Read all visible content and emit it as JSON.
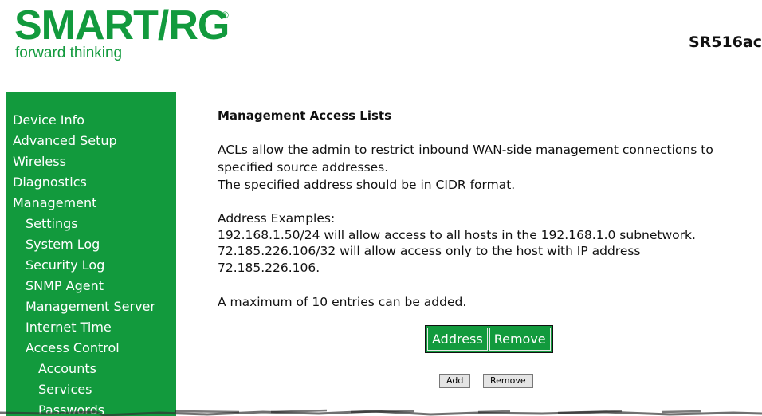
{
  "brand": {
    "logo_text": "SMART/RG",
    "registered_mark": "®",
    "tagline": "forward thinking",
    "model": "SR516ac",
    "color": "#129a3d"
  },
  "sidebar": {
    "items": [
      {
        "label": "Device Info",
        "level": 0
      },
      {
        "label": "Advanced Setup",
        "level": 0
      },
      {
        "label": "Wireless",
        "level": 0
      },
      {
        "label": "Diagnostics",
        "level": 0
      },
      {
        "label": "Management",
        "level": 0
      },
      {
        "label": "Settings",
        "level": 1
      },
      {
        "label": "System Log",
        "level": 1
      },
      {
        "label": "Security Log",
        "level": 1
      },
      {
        "label": "SNMP Agent",
        "level": 1
      },
      {
        "label": "Management Server",
        "level": 1
      },
      {
        "label": "Internet Time",
        "level": 1
      },
      {
        "label": "Access Control",
        "level": 1
      },
      {
        "label": "Accounts",
        "level": 2
      },
      {
        "label": "Services",
        "level": 2
      },
      {
        "label": "Passwords",
        "level": 2
      }
    ]
  },
  "main": {
    "title": "Management Access Lists",
    "description_1": "ACLs allow the admin to restrict inbound WAN-side management connections to",
    "description_2": "specified source addresses.",
    "description_3": "The specified address should be in CIDR format.",
    "examples_heading": "Address Examples:",
    "example_1": "192.168.1.50/24 will allow access to all hosts in the 192.168.1.0 subnetwork.",
    "example_2a": "72.185.226.106/32 will allow access only to the host with IP address",
    "example_2b": "72.185.226.106.",
    "max_entries": "A maximum of 10 entries can be added.",
    "table": {
      "columns": [
        "Address",
        "Remove"
      ]
    },
    "buttons": {
      "add": "Add",
      "remove": "Remove"
    }
  }
}
